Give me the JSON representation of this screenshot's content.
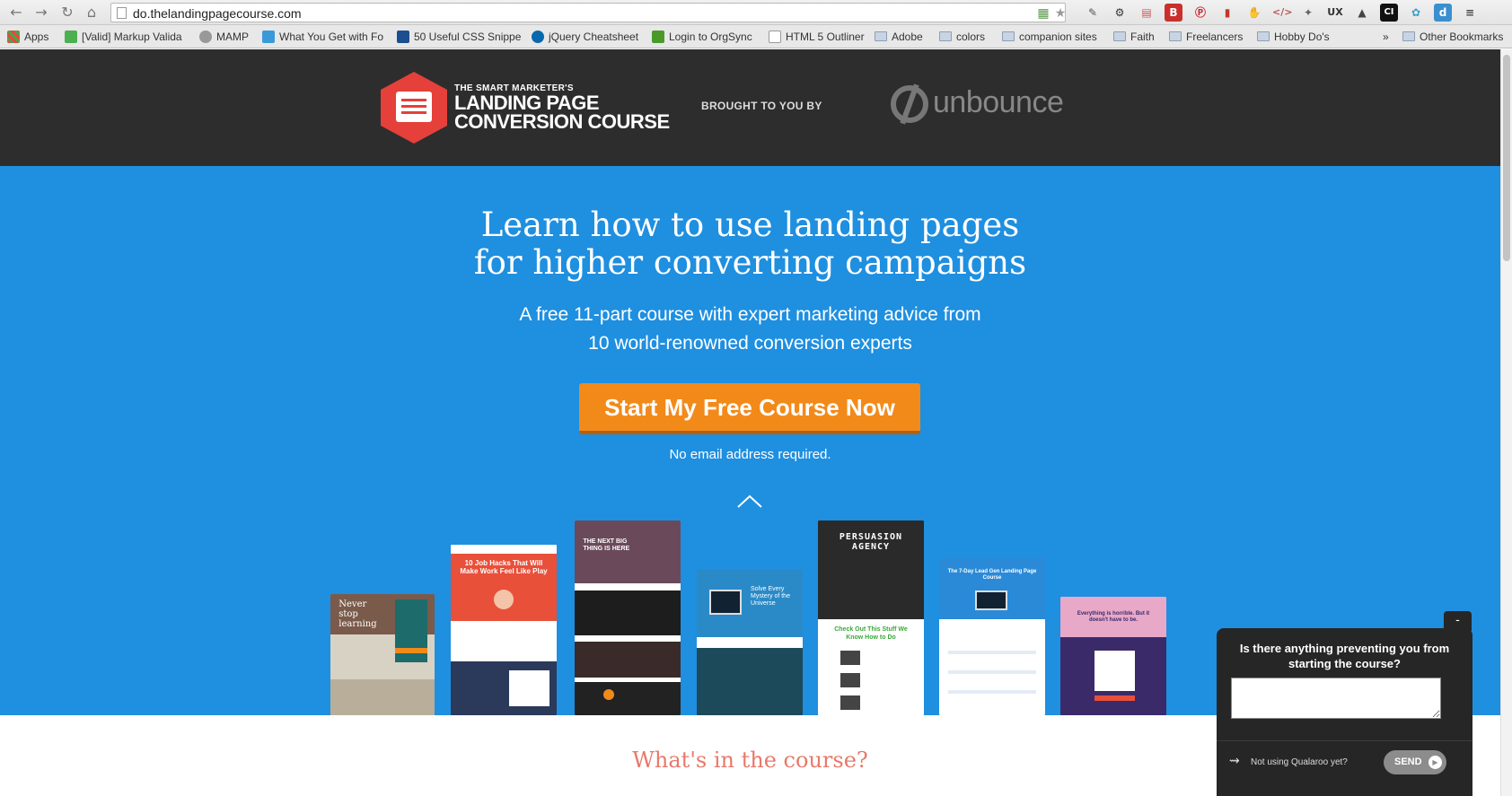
{
  "browser": {
    "url": "do.thelandingpagecourse.com",
    "back_icon": "arrow-left",
    "forward_icon": "arrow-right",
    "reload_icon": "reload",
    "home_icon": "home",
    "extensions": [
      "eyedropper",
      "gear",
      "calendar",
      "B",
      "pinterest",
      "couch",
      "evernote",
      "code",
      "tool",
      "UX",
      "silhouette",
      "CI",
      "molecule",
      "d",
      "menu"
    ]
  },
  "bookmarks": {
    "items": [
      {
        "label": "Apps"
      },
      {
        "label": "[Valid] Markup Valida"
      },
      {
        "label": "MAMP"
      },
      {
        "label": "What You Get with Fo"
      },
      {
        "label": "50 Useful CSS Snippe"
      },
      {
        "label": "jQuery Cheatsheet"
      },
      {
        "label": "Login to OrgSync"
      },
      {
        "label": "HTML 5 Outliner"
      },
      {
        "label": "Adobe"
      },
      {
        "label": "colors"
      },
      {
        "label": "companion sites"
      },
      {
        "label": "Faith"
      },
      {
        "label": "Freelancers"
      },
      {
        "label": "Hobby Do's"
      }
    ],
    "overflow": "»",
    "other": "Other Bookmarks"
  },
  "header": {
    "logo_small": "THE SMART MARKETER'S",
    "logo_line1": "LANDING PAGE",
    "logo_line2": "CONVERSION COURSE",
    "brought_by": "BROUGHT TO YOU BY",
    "partner": "unbounce"
  },
  "hero": {
    "headline_line1": "Learn how to use landing pages",
    "headline_line2": "for higher converting campaigns",
    "sub_line1": "A free 11-part course with expert marketing advice from",
    "sub_line2": "10 world-renowned conversion experts",
    "cta_label": "Start My Free Course Now",
    "note": "No email address required.",
    "colors": {
      "background": "#1f8fe0",
      "cta": "#f28a1a",
      "header": "#2d2d2d"
    }
  },
  "thumbs": {
    "t1": "Never stop learning",
    "t2": "10 Job Hacks That Will Make Work Feel Like Play",
    "t3": "THE NEXT BIG THING IS HERE",
    "t4": "Solve Every Mystery of the Universe",
    "t5_title": "PERSUASION AGENCY",
    "t5_cta": "Check Out This Stuff We Know How to Do",
    "t6": "The 7-Day Lead Gen Landing Page Course",
    "t7": "Everything is horrible. But it doesn't have to be."
  },
  "section": {
    "heading": "What's in the course?"
  },
  "survey": {
    "minimize": "-",
    "question": "Is there anything preventing you from starting the course?",
    "brand": "Not using Qualaroo yet?",
    "send": "SEND"
  }
}
